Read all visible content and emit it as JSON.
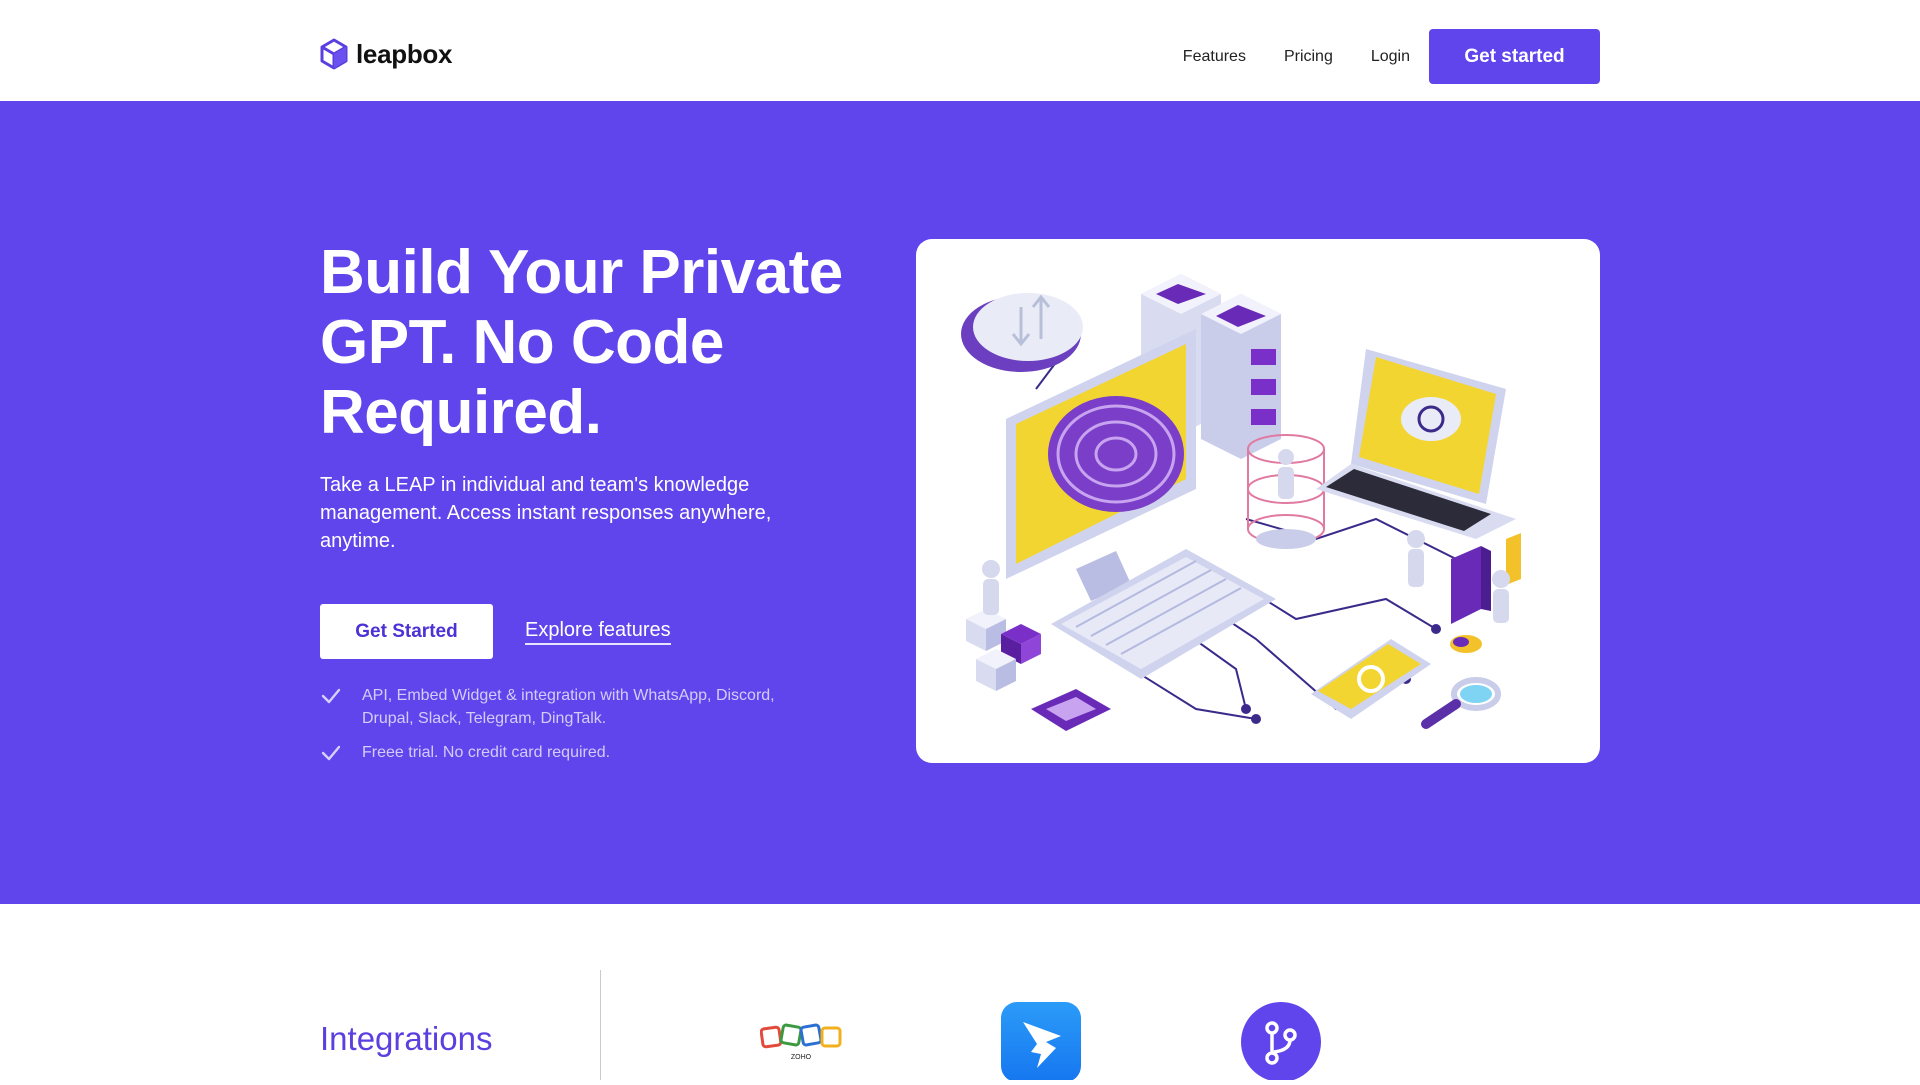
{
  "brand": {
    "name": "leapbox",
    "accent": "#6045ec"
  },
  "nav": {
    "links": [
      "Features",
      "Pricing",
      "Login"
    ],
    "cta": "Get started"
  },
  "hero": {
    "title_lines": [
      "Build Your Private",
      "GPT. No Code",
      "Required."
    ],
    "subtitle": "Take a LEAP in individual and team's knowledge management. Access instant responses anywhere, anytime.",
    "primary_cta": "Get Started",
    "secondary_cta": "Explore features",
    "checks": [
      "API, Embed Widget & integration with WhatsApp, Discord, Drupal, Slack, Telegram, DingTalk.",
      "Freee trial. No credit card required."
    ],
    "illustration": "isometric-ai-tech-illustration"
  },
  "integrations": {
    "title": "Integrations",
    "logos": [
      {
        "name": "zoho-logo",
        "label": "ZOHO"
      },
      {
        "name": "dingtalk-logo"
      },
      {
        "name": "git-merge-logo"
      }
    ]
  }
}
